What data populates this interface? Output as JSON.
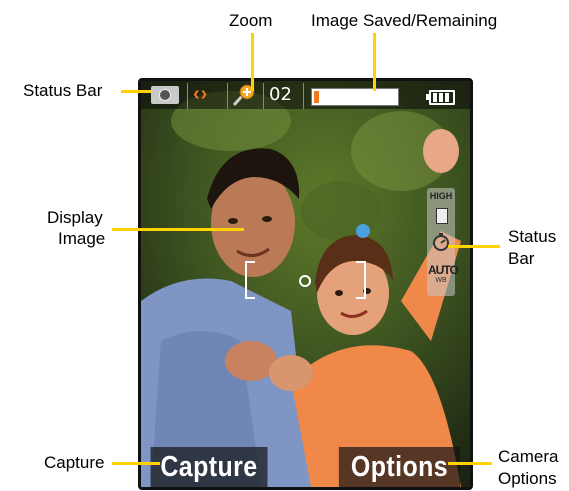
{
  "callouts": {
    "zoom": "Zoom",
    "image_saved": "Image Saved/Remaining",
    "status_bar_left": "Status Bar",
    "display_image_1": "Display",
    "display_image_2": "Image",
    "status_bar_right_1": "Status",
    "status_bar_right_2": "Bar",
    "capture": "Capture",
    "camera_options_1": "Camera",
    "camera_options_2": "Options"
  },
  "colors": {
    "callout_line": "#ffd200",
    "accent_orange": "#f07820"
  },
  "status_bar": {
    "mode_icon": "camera-icon",
    "arrows": "‹›",
    "zoom_icon": "zoom-icon",
    "image_count": "02",
    "memory_used_fraction": 0.06,
    "battery_icon": "battery-icon"
  },
  "side_panel": {
    "quality": "HIGH",
    "storage_icon": "memory-card-icon",
    "timer_icon": "self-timer-icon",
    "white_balance": "AUTO",
    "white_balance_sub": "WB"
  },
  "softkeys": {
    "left": "Capture",
    "right": "Options"
  }
}
